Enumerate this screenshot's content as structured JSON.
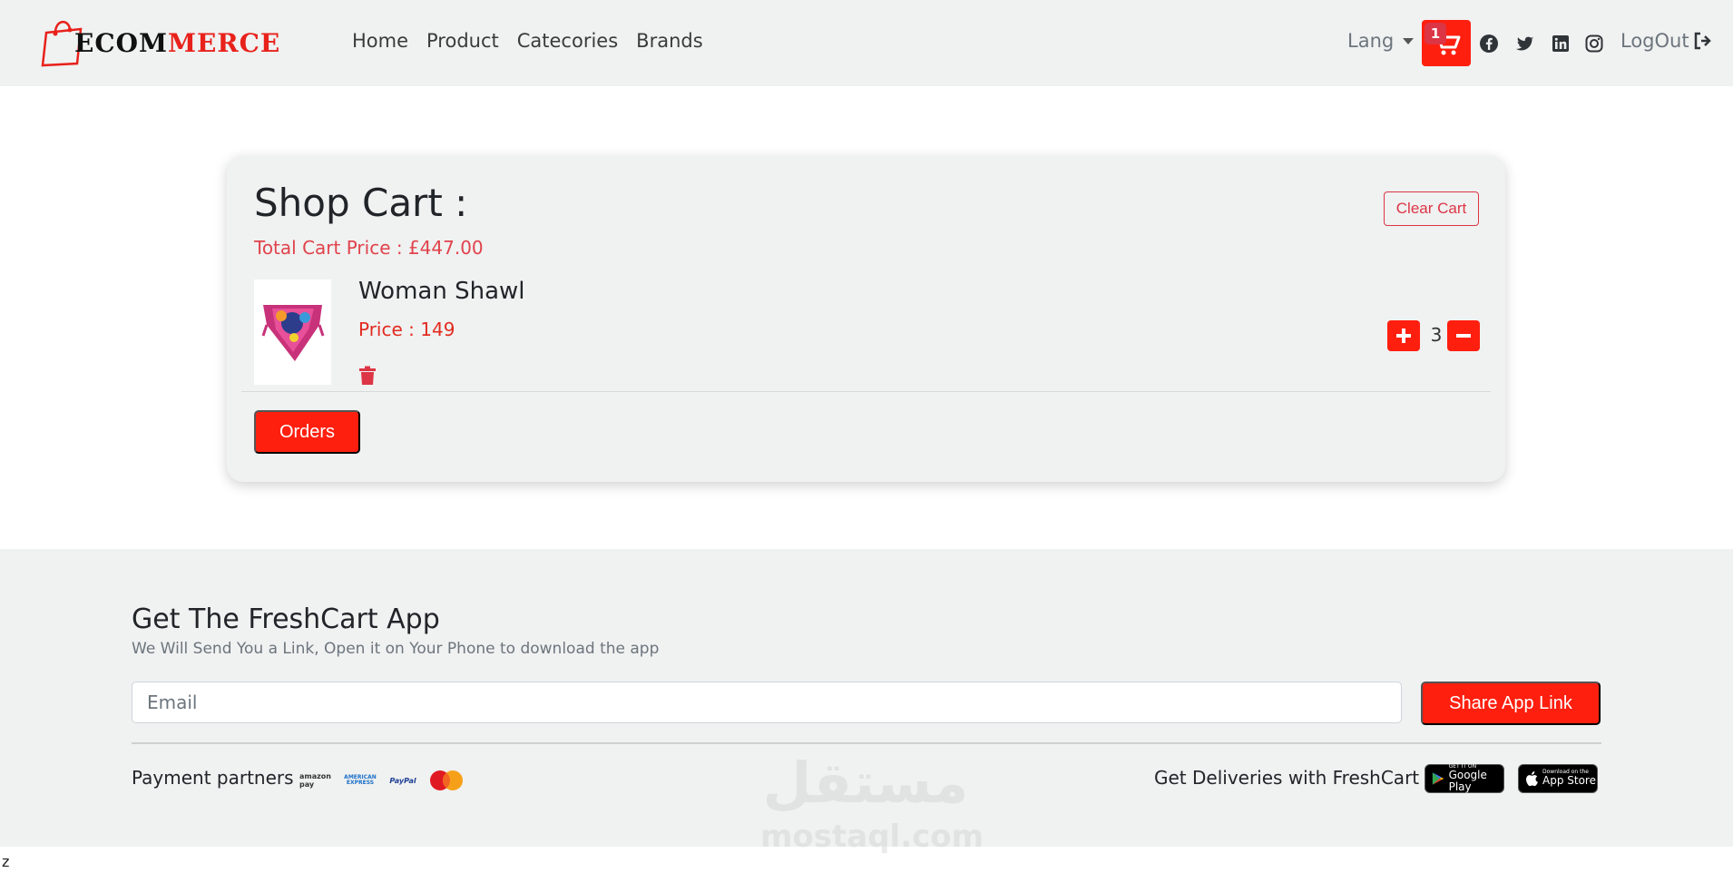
{
  "brand": {
    "logo_prefix": "E",
    "logo_mid": "COM",
    "logo_suffix": "MERCE"
  },
  "nav": {
    "links": [
      "Home",
      "Product",
      "Catecories",
      "Brands"
    ]
  },
  "header": {
    "lang_label": "Lang",
    "cart_count": "1",
    "logout_label": "LogOut"
  },
  "cart": {
    "title": "Shop Cart :",
    "total_label": "Total Cart Price : £447.00",
    "clear_label": "Clear Cart",
    "items": [
      {
        "name": "Woman Shawl",
        "price_label": "Price : 149",
        "quantity": "3"
      }
    ],
    "orders_label": "Orders"
  },
  "footer": {
    "title": "Get The FreshCart App",
    "subtitle": "We Will Send You a Link, Open it on Your Phone to download the app",
    "email_placeholder": "Email",
    "share_label": "Share App Link",
    "payment_label": "Payment partners",
    "payment_logos": [
      "amazon pay",
      "AMERICAN EXPRESS",
      "PayPal",
      "MasterCard"
    ],
    "delivery_label": "Get Deliveries with FreshCart",
    "google_small": "GET IT ON",
    "google_big": "Google Play",
    "apple_small": "Download on the",
    "apple_big": "App Store"
  },
  "watermark": {
    "arabic": "مستقل",
    "latin": "mostaql.com"
  },
  "stray_text": "z",
  "colors": {
    "accent": "#ff1f0f",
    "danger": "#dc3545",
    "bg_gray": "#f0f1f1"
  }
}
